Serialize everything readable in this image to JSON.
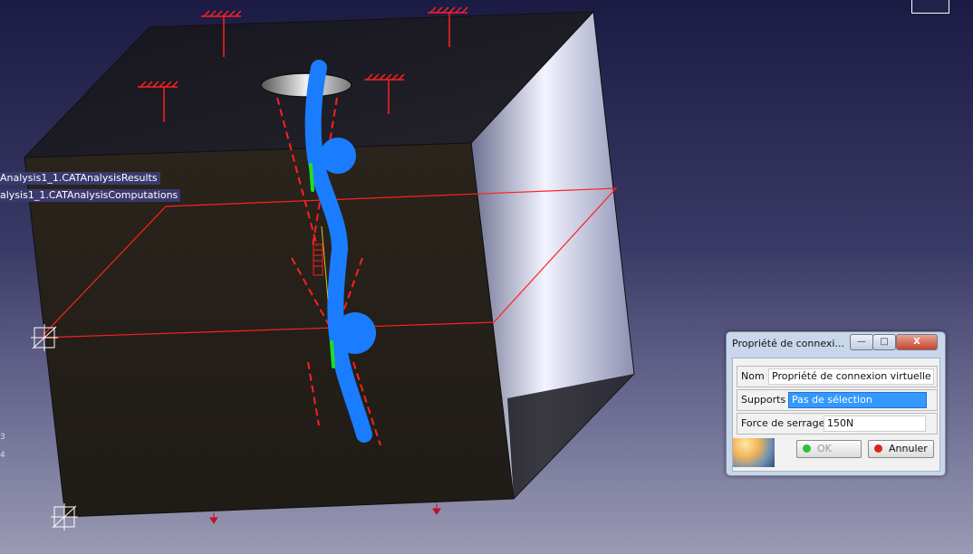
{
  "tree": {
    "item1": "Analysis1_1.CATAnalysisResults",
    "item2": "alysis1_1.CATAnalysisComputations"
  },
  "edge_numbers": [
    "3",
    "4"
  ],
  "dialog": {
    "title": "Propriété de connexi...",
    "window_buttons": {
      "minimize": "—",
      "maximize": "□",
      "close": "X"
    },
    "fields": {
      "nom_label": "Nom",
      "nom_value": "Propriété de connexion virtuelle",
      "supports_label": "Supports",
      "supports_value": "Pas de sélection",
      "force_label": "Force de serrage",
      "force_value": "150N"
    },
    "buttons": {
      "ok": "OK",
      "cancel": "Annuler"
    }
  },
  "colors": {
    "restraint": "#ff2020",
    "bolt": "#1a7dff",
    "contact": "#22dd22",
    "ok_dot": "#2fbf3a",
    "cancel_dot": "#d9261c"
  },
  "icons": [
    "clamp-restraint-icon",
    "axis-triad-icon",
    "force-arrow-icon",
    "window-minimize-icon",
    "window-maximize-icon",
    "window-close-icon"
  ]
}
